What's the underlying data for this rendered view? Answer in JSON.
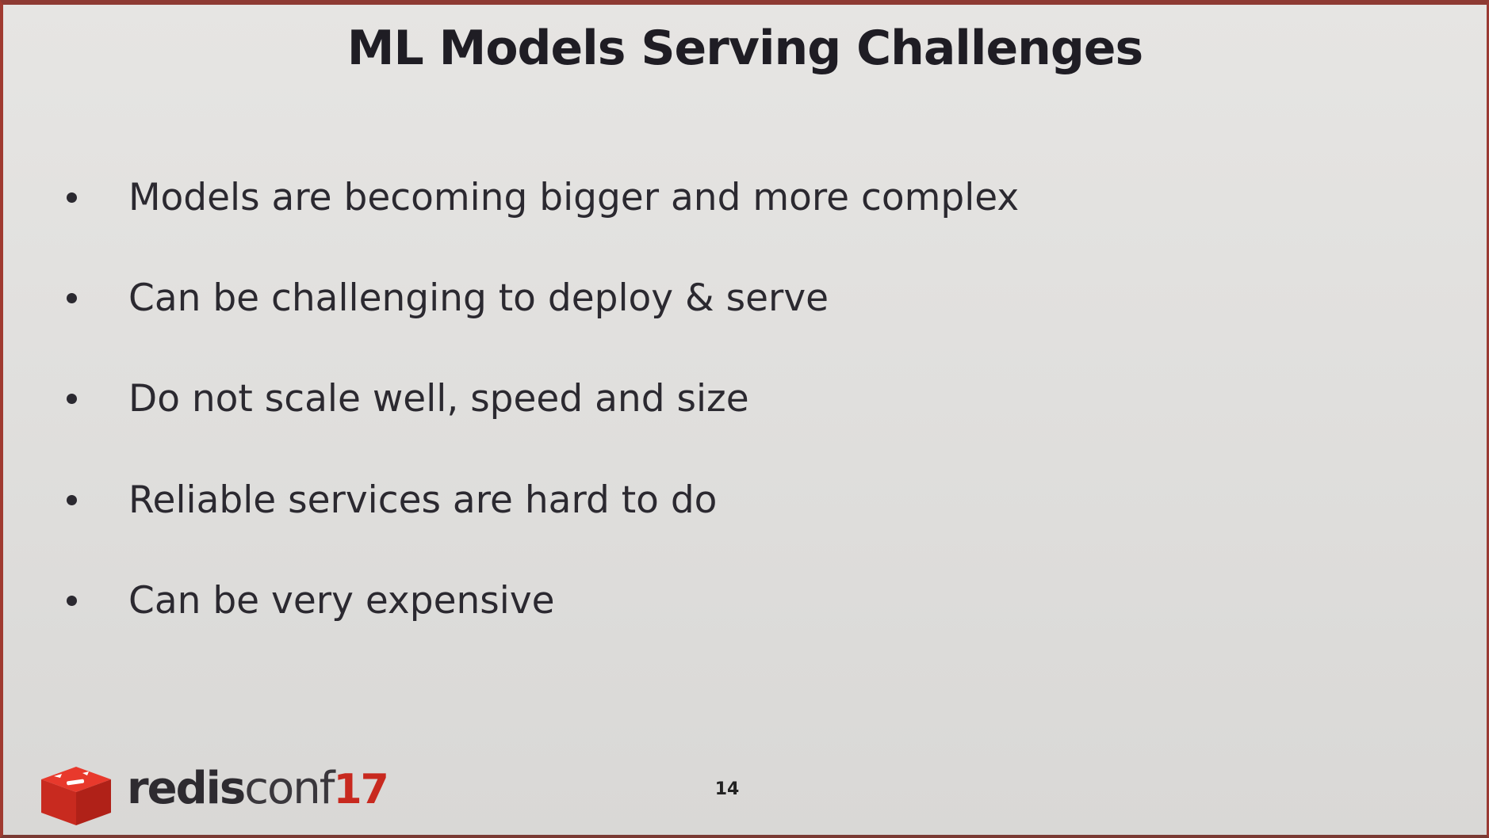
{
  "slide": {
    "title": "ML Models Serving Challenges",
    "bullets": [
      "Models are becoming bigger and more complex",
      "Can be challenging to deploy & serve",
      "Do not scale well, speed and size",
      "Reliable services are hard to do",
      "Can be very expensive"
    ],
    "page_number": "14"
  },
  "footer": {
    "brand_redis": "redis",
    "brand_conf": "conf",
    "brand_year": "17",
    "logo_icon": "redis-cube-logo-icon"
  },
  "colors": {
    "title": "#1f1d24",
    "text": "#2b2930",
    "accent_red": "#c8291f",
    "background": "#e2e1df"
  }
}
